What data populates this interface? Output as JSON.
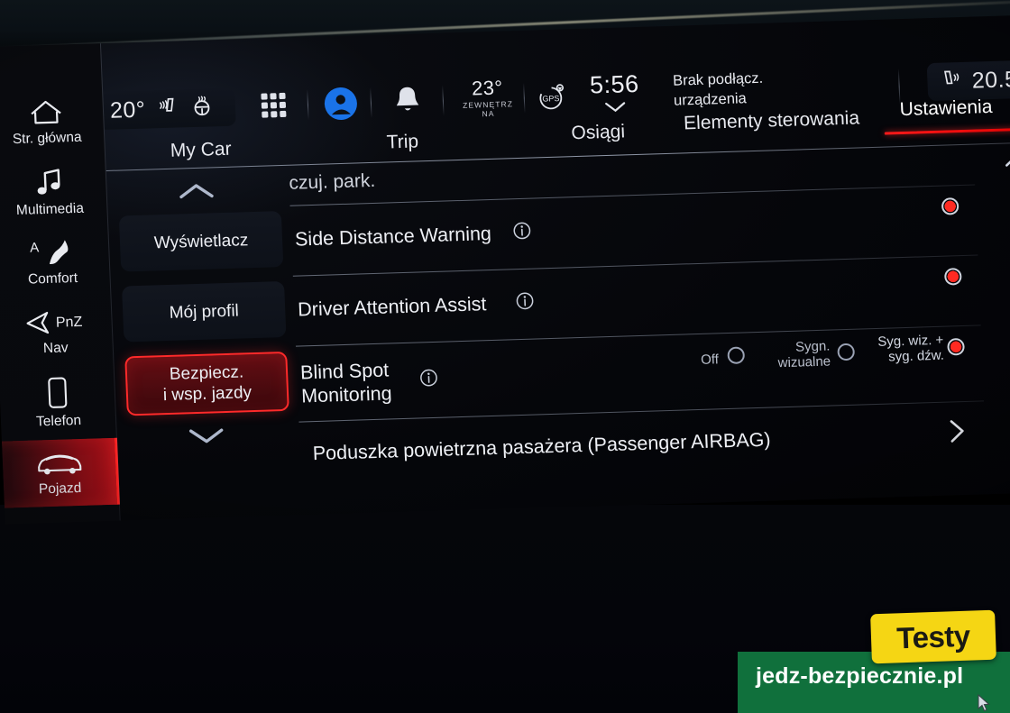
{
  "status_bar": {
    "climate_temp": "20°",
    "seat_heat_icon": "seat-heating-icon",
    "wheel_heat_icon": "steering-wheel-heating-icon",
    "apps_icon": "app-grid-icon",
    "profile_icon": "user-profile-icon",
    "notifications_icon": "bell-icon",
    "outside_temp": "23°",
    "outside_temp_label_line1": "ZEWNĘTRZ",
    "outside_temp_label_line2": "NA",
    "gps_icon": "gps-icon",
    "clock": "5:56",
    "clock_chevron_icon": "chevron-down-icon",
    "bluetooth_line1": "Brak podłącz.",
    "bluetooth_line2": "urządzenia",
    "right_climate_temp": "20.5",
    "right_seat_icon": "seat-heating-icon"
  },
  "tabs": [
    {
      "label": "My Car",
      "active": false
    },
    {
      "label": "Trip",
      "active": false
    },
    {
      "label": "Osiągi",
      "active": false
    },
    {
      "label": "Elementy sterowania",
      "active": false
    },
    {
      "label": "Ustawienia",
      "active": true
    }
  ],
  "sidebar": {
    "items": [
      {
        "label": "Str. główna",
        "icon": "home-icon",
        "selected": false
      },
      {
        "label": "Multimedia",
        "icon": "music-note-icon",
        "selected": false
      },
      {
        "label": "Comfort",
        "icon": "seat-comfort-icon",
        "selected": false
      },
      {
        "label": "Nav",
        "icon": "navigation-arrow-icon",
        "selected": false
      },
      {
        "label": "Telefon",
        "icon": "phone-icon",
        "selected": false
      },
      {
        "label": "Pojazd",
        "icon": "car-icon",
        "selected": true
      }
    ]
  },
  "category_panel": {
    "scroll_up_icon": "chevron-up-icon",
    "scroll_down_icon": "chevron-down-icon",
    "buttons": [
      {
        "label": "Wyświetlacz",
        "selected": false
      },
      {
        "label": "Mój profil",
        "selected": false
      },
      {
        "label_line1": "Bezpiecz.",
        "label_line2": "i wsp. jazdy",
        "selected": true
      }
    ]
  },
  "settings_list": {
    "partial_top_row": "czuj. park.",
    "rows": [
      {
        "title": "Side Distance Warning",
        "info_icon": "info-icon",
        "control": "radio",
        "indicator_state": "on"
      },
      {
        "title": "Driver Attention Assist",
        "info_icon": "info-icon",
        "control": "radio",
        "indicator_state": "on"
      },
      {
        "title_line1": "Blind Spot",
        "title_line2": "Monitoring",
        "info_icon": "info-icon",
        "control": "radio-group",
        "options": [
          {
            "label": "Off",
            "selected": false
          },
          {
            "label_line1": "Sygn.",
            "label_line2": "wizualne",
            "selected": false
          },
          {
            "label_line1": "Syg. wiz. +",
            "label_line2": "syg. dźw.",
            "selected": true
          }
        ]
      },
      {
        "title": "Poduszka powietrzna pasażera (Passenger AIRBAG)",
        "control": "chevron",
        "chevron_icon": "chevron-right-icon"
      }
    ],
    "scrollbar": {
      "up_icon": "chevron-up-icon",
      "down_icon": "chevron-down-icon"
    }
  },
  "watermark": {
    "badge": "Testy",
    "url": "jedz-bezpiecznie.pl",
    "cursor_icon": "mouse-cursor-icon"
  },
  "colors": {
    "accent_red": "#ff2a2a",
    "selected_red": "#e00000",
    "profile_blue": "#1a73e8",
    "badge_yellow": "#f5d614",
    "banner_green": "#10703c"
  }
}
